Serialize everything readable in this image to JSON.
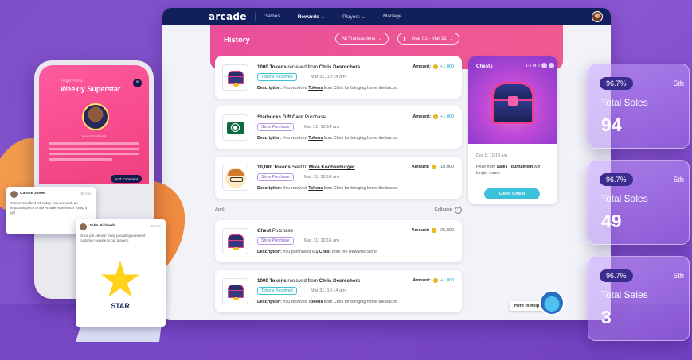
{
  "nav": {
    "logo": "arcade",
    "items": [
      "Games",
      "Rewards ⌄",
      "Players ⌄",
      "Manage"
    ]
  },
  "history": {
    "title": "History",
    "filter": "All Transactions",
    "date_range": "Mar 01 - Mar 31"
  },
  "transactions": [
    {
      "title_pre": "1000 Tokens",
      "title_mid": " recieved from ",
      "title_bold": "Chris Desrochers",
      "tag": "Tokens Received",
      "date": "Mar 31, 10:14 am",
      "desc_pre": "You received ",
      "desc_link": "Tokens",
      "desc_post": " from Chris for bringing home the bacon.",
      "amount": "+1,000"
    },
    {
      "title_pre": "Starbucks Gift Card",
      "title_mid": " Purchase",
      "title_bold": "",
      "tag": "Store Purchase",
      "date": "Mar 31, 10:14 am",
      "desc_pre": "You received ",
      "desc_link": "Tokens",
      "desc_post": " from Chris for bringing home the bacon.",
      "amount": "+1,000"
    },
    {
      "title_pre": "10,000 Tokens",
      "title_mid": " Sent to ",
      "title_bold": "Mike Kochenburger",
      "tag": "Store Purchase",
      "date": "Mar 31, 10:14 am",
      "desc_pre": "You received ",
      "desc_link": "Tokens",
      "desc_post": " from Chris for bringing home the bacon.",
      "amount": "-10,000"
    },
    {
      "title_pre": "Chest",
      "title_mid": " Purchase",
      "title_bold": "",
      "tag": "Store Purchase",
      "date": "Mar 31, 10:14 am",
      "desc_pre": "You purchased a ",
      "desc_link": "1 Chest",
      "desc_post": " from the Rewards Store.",
      "amount": "-25,000"
    },
    {
      "title_pre": "1000 Tokens",
      "title_mid": " recieved from ",
      "title_bold": "Chris Desrochers",
      "tag": "Tokens Received",
      "date": "Mar 31, 10:14 am",
      "desc_pre": "You received ",
      "desc_link": "Tokens",
      "desc_post": " from Chris for bringing home the bacon.",
      "amount": "+1,000"
    }
  ],
  "labels": {
    "amount": "Amount:",
    "description": "Description:"
  },
  "divider": {
    "month": "April",
    "collapse": "Collapse"
  },
  "chests": {
    "title": "Chests",
    "count": "1-2 of 2",
    "date": "Dec 8, 10:14 am",
    "prize_pre": "Prize from ",
    "prize_bold": "Sales Tournament",
    "prize_post": " with longer name.",
    "open_button": "Open Chest"
  },
  "help": {
    "label": "Here to help!"
  },
  "phone": {
    "small": "Forget Promo",
    "title": "Weekly Superstar",
    "name": "Inovon Mclaren",
    "comment_button": "Add Comment"
  },
  "posts": [
    {
      "name": "Carson Jones",
      "time": "30 min",
      "text": "Jones! Excellent job today. You are such an important piece to the Arcade experience. Keep it up!"
    },
    {
      "name": "John Richards",
      "time": "20 min",
      "text": "Great job James! Keep providing excellent customer service to our players.",
      "art": "STAR"
    }
  ],
  "stats": [
    {
      "badge": "96.7%",
      "rank": "5th",
      "label": "Total Sales",
      "value": "94"
    },
    {
      "badge": "96.7%",
      "rank": "5th",
      "label": "Total Sales",
      "value": "49"
    },
    {
      "badge": "96.7%",
      "rank": "5th",
      "label": "Total Sales",
      "value": "3"
    }
  ],
  "colors": {
    "background": "#8a56d2",
    "nav": "#11205a",
    "accent_pink": "#ea4f9b",
    "accent_teal": "#39c2d9"
  }
}
